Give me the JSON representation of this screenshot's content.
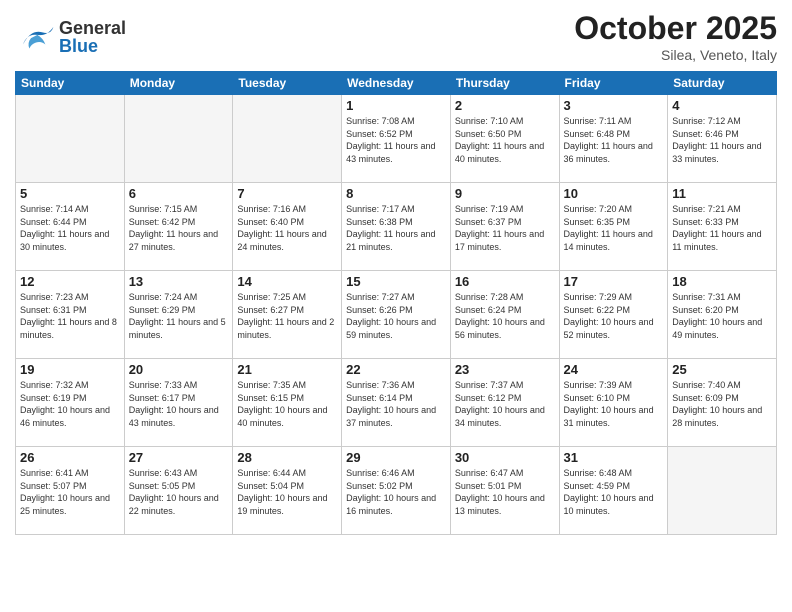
{
  "header": {
    "logo": {
      "general": "General",
      "blue": "Blue"
    },
    "month": "October 2025",
    "location": "Silea, Veneto, Italy"
  },
  "weekdays": [
    "Sunday",
    "Monday",
    "Tuesday",
    "Wednesday",
    "Thursday",
    "Friday",
    "Saturday"
  ],
  "days": [
    {
      "date": "",
      "sunrise": "",
      "sunset": "",
      "daylight": "",
      "empty": true
    },
    {
      "date": "",
      "sunrise": "",
      "sunset": "",
      "daylight": "",
      "empty": true
    },
    {
      "date": "",
      "sunrise": "",
      "sunset": "",
      "daylight": "",
      "empty": true
    },
    {
      "date": "1",
      "sunrise": "7:08 AM",
      "sunset": "6:52 PM",
      "daylight": "11 hours and 43 minutes."
    },
    {
      "date": "2",
      "sunrise": "7:10 AM",
      "sunset": "6:50 PM",
      "daylight": "11 hours and 40 minutes."
    },
    {
      "date": "3",
      "sunrise": "7:11 AM",
      "sunset": "6:48 PM",
      "daylight": "11 hours and 36 minutes."
    },
    {
      "date": "4",
      "sunrise": "7:12 AM",
      "sunset": "6:46 PM",
      "daylight": "11 hours and 33 minutes."
    },
    {
      "date": "5",
      "sunrise": "7:14 AM",
      "sunset": "6:44 PM",
      "daylight": "11 hours and 30 minutes."
    },
    {
      "date": "6",
      "sunrise": "7:15 AM",
      "sunset": "6:42 PM",
      "daylight": "11 hours and 27 minutes."
    },
    {
      "date": "7",
      "sunrise": "7:16 AM",
      "sunset": "6:40 PM",
      "daylight": "11 hours and 24 minutes."
    },
    {
      "date": "8",
      "sunrise": "7:17 AM",
      "sunset": "6:38 PM",
      "daylight": "11 hours and 21 minutes."
    },
    {
      "date": "9",
      "sunrise": "7:19 AM",
      "sunset": "6:37 PM",
      "daylight": "11 hours and 17 minutes."
    },
    {
      "date": "10",
      "sunrise": "7:20 AM",
      "sunset": "6:35 PM",
      "daylight": "11 hours and 14 minutes."
    },
    {
      "date": "11",
      "sunrise": "7:21 AM",
      "sunset": "6:33 PM",
      "daylight": "11 hours and 11 minutes."
    },
    {
      "date": "12",
      "sunrise": "7:23 AM",
      "sunset": "6:31 PM",
      "daylight": "11 hours and 8 minutes."
    },
    {
      "date": "13",
      "sunrise": "7:24 AM",
      "sunset": "6:29 PM",
      "daylight": "11 hours and 5 minutes."
    },
    {
      "date": "14",
      "sunrise": "7:25 AM",
      "sunset": "6:27 PM",
      "daylight": "11 hours and 2 minutes."
    },
    {
      "date": "15",
      "sunrise": "7:27 AM",
      "sunset": "6:26 PM",
      "daylight": "10 hours and 59 minutes."
    },
    {
      "date": "16",
      "sunrise": "7:28 AM",
      "sunset": "6:24 PM",
      "daylight": "10 hours and 56 minutes."
    },
    {
      "date": "17",
      "sunrise": "7:29 AM",
      "sunset": "6:22 PM",
      "daylight": "10 hours and 52 minutes."
    },
    {
      "date": "18",
      "sunrise": "7:31 AM",
      "sunset": "6:20 PM",
      "daylight": "10 hours and 49 minutes."
    },
    {
      "date": "19",
      "sunrise": "7:32 AM",
      "sunset": "6:19 PM",
      "daylight": "10 hours and 46 minutes."
    },
    {
      "date": "20",
      "sunrise": "7:33 AM",
      "sunset": "6:17 PM",
      "daylight": "10 hours and 43 minutes."
    },
    {
      "date": "21",
      "sunrise": "7:35 AM",
      "sunset": "6:15 PM",
      "daylight": "10 hours and 40 minutes."
    },
    {
      "date": "22",
      "sunrise": "7:36 AM",
      "sunset": "6:14 PM",
      "daylight": "10 hours and 37 minutes."
    },
    {
      "date": "23",
      "sunrise": "7:37 AM",
      "sunset": "6:12 PM",
      "daylight": "10 hours and 34 minutes."
    },
    {
      "date": "24",
      "sunrise": "7:39 AM",
      "sunset": "6:10 PM",
      "daylight": "10 hours and 31 minutes."
    },
    {
      "date": "25",
      "sunrise": "7:40 AM",
      "sunset": "6:09 PM",
      "daylight": "10 hours and 28 minutes."
    },
    {
      "date": "26",
      "sunrise": "6:41 AM",
      "sunset": "5:07 PM",
      "daylight": "10 hours and 25 minutes."
    },
    {
      "date": "27",
      "sunrise": "6:43 AM",
      "sunset": "5:05 PM",
      "daylight": "10 hours and 22 minutes."
    },
    {
      "date": "28",
      "sunrise": "6:44 AM",
      "sunset": "5:04 PM",
      "daylight": "10 hours and 19 minutes."
    },
    {
      "date": "29",
      "sunrise": "6:46 AM",
      "sunset": "5:02 PM",
      "daylight": "10 hours and 16 minutes."
    },
    {
      "date": "30",
      "sunrise": "6:47 AM",
      "sunset": "5:01 PM",
      "daylight": "10 hours and 13 minutes."
    },
    {
      "date": "31",
      "sunrise": "6:48 AM",
      "sunset": "4:59 PM",
      "daylight": "10 hours and 10 minutes."
    },
    {
      "date": "",
      "sunrise": "",
      "sunset": "",
      "daylight": "",
      "empty": true
    }
  ]
}
